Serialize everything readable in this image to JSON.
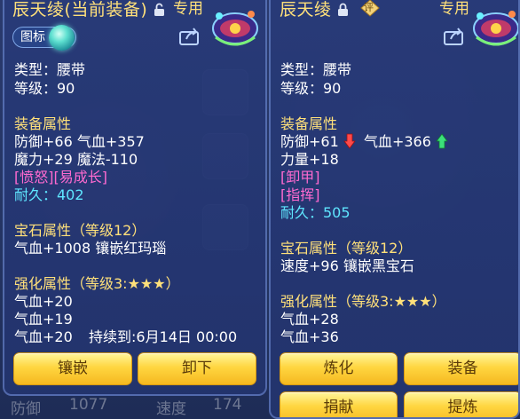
{
  "background": {
    "stat1_label": "防御",
    "stat1_value": "1077",
    "stat2_label": "速度",
    "stat2_value": "174"
  },
  "left_panel": {
    "title": "辰天绫(当前装备)",
    "exclusive": "专用",
    "tag_label": "图标",
    "type_line": "类型：腰带",
    "level_line": "等级：90",
    "equip_attr_header": "装备属性",
    "attr_line1": "防御+66 气血+357",
    "attr_line2": "魔力+29 魔法-110",
    "special_tags": "[愤怒][易成长]",
    "durability": "耐久：402",
    "gem_header": "宝石属性（等级12）",
    "gem_line": "气血+1008 镶嵌红玛瑙",
    "enhance_header": "强化属性（等级3:★★★）",
    "enhance_line1": "气血+20",
    "enhance_line2": "气血+19",
    "enhance_line3": "气血+20",
    "duration": "持续到:6月14日 00:00",
    "buttons": [
      "镶嵌",
      "卸下"
    ]
  },
  "right_panel": {
    "title": "辰天绫",
    "exclusive": "专用",
    "badge": "评",
    "type_line": "类型：腰带",
    "level_line": "等级：90",
    "equip_attr_header": "装备属性",
    "attr_defense": "防御+61",
    "attr_hp": "气血+366",
    "attr_line2": "力量+18",
    "special_tag1": "[卸甲]",
    "special_tag2": "[指挥]",
    "durability": "耐久：505",
    "gem_header": "宝石属性（等级12）",
    "gem_line": "速度+96 镶嵌黑宝石",
    "enhance_header": "强化属性（等级3:★★★）",
    "enhance_line1": "气血+28",
    "enhance_line2": "气血+36",
    "buttons": [
      "炼化",
      "装备",
      "捐献",
      "提炼"
    ]
  },
  "colors": {
    "header_gold": "#ffe07a",
    "special_pink": "#ff6ad0",
    "durability_cyan": "#5fe6ff",
    "button_gold": "#ffd640"
  }
}
